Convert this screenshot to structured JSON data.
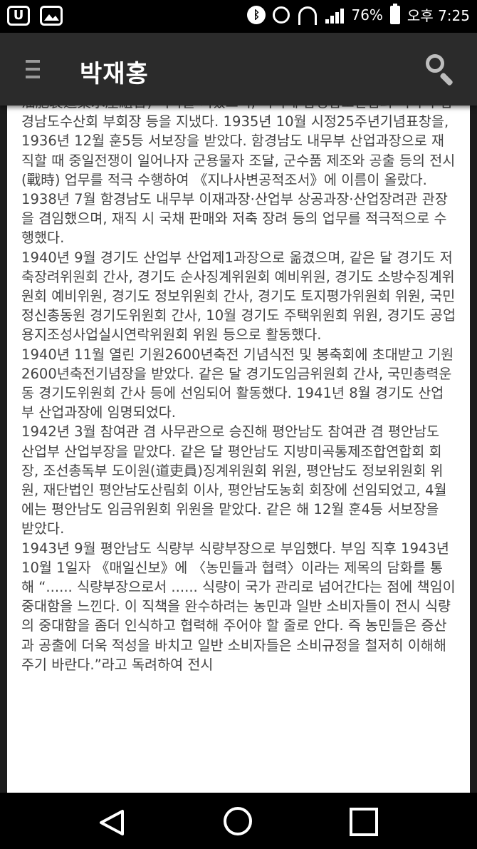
{
  "status_bar": {
    "battery": "76%",
    "time": "오후 7:25",
    "icons": [
      "u-plus-icon",
      "gallery-icon",
      "bluetooth-icon",
      "alarm-icon",
      "wifi-icon",
      "signal-icon",
      "battery-icon"
    ]
  },
  "app_bar": {
    "title": "박재홍",
    "icons": [
      "menu-icon",
      "search-icon"
    ]
  },
  "article": {
    "paragraphs": [
      "油肥製造業水産組合) 이사를 지냈으며, 이외에 함경남도산림회 이사와 함경남도수산회 부회장 등을 지냈다. 1935년 10월 시정25주년기념표창을, 1936년 12월 훈5등 서보장을 받았다. 함경남도 내무부 산업과장으로 재직할 때 중일전쟁이 일어나자 군용물자 조달, 군수품 제조와 공출 등의 전시(戰時) 업무를 적극 수행하여 《지나사변공적조서》에 이름이 올랐다. 1938년 7월 함경남도 내무부 이재과장·산업부 상공과장·산업장려관 관장을 겸임했으며, 재직 시 국채 판매와 저축 장려 등의 업무를 적극적으로 수행했다.",
      "1940년 9월 경기도 산업부 산업제1과장으로 옮겼으며, 같은 달 경기도 저축장려위원회 간사, 경기도 순사징계위원회 예비위원, 경기도 소방수징계위원회 예비위원, 경기도 정보위원회 간사, 경기도 토지평가위원회 위원, 국민정신총동원 경기도위원회 간사, 10월 경기도 주택위원회 위원, 경기도 공업용지조성사업실시연락위원회 위원 등으로 활동했다.",
      "1940년 11월 열린 기원2600년축전 기념식전 및 봉축회에 초대받고 기원2600년축전기념장을 받았다. 같은 달 경기도임금위원회 간사, 국민총력운동 경기도위원회 간사 등에 선임되어 활동했다. 1941년 8월 경기도 산업부 산업과장에 임명되었다.",
      "1942년 3월 참여관 겸 사무관으로 승진해 평안남도 참여관 겸 평안남도 산업부 산업부장을 맡았다. 같은 달 평안남도 지방미곡통제조합연합회 회장, 조선총독부 도이원(道吏員)징계위원회 위원, 평안남도 정보위원회 위원, 재단법인 평안남도산림회 이사, 평안남도농회 회장에 선임되었고, 4월에는 평안남도 임금위원회 위원을 맡았다. 같은 해 12월 훈4등 서보장을 받았다.",
      "1943년 9월 평안남도 식량부 식량부장으로 부임했다. 부임 직후 1943년 10월 1일자 《매일신보》에 〈농민들과 협력〉이라는 제목의 담화를 통해 “...... 식량부장으로서 ...... 식량이 국가 관리로 넘어간다는 점에 책임이 중대함을 느낀다. 이 직책을 완수하려는 농민과 일반 소비자들이 전시 식량의 중대함을 좀더 인식하고 협력해 주어야 할 줄로 안다. 즉 농민들은 증산과 공출에 더욱 적성을 바치고 일반 소비자들은 소비규정을 철저히 이해해 주기 바란다.”라고 독려하여 전시"
    ]
  },
  "nav_bar": {
    "icons": [
      "back-icon",
      "home-icon",
      "recent-apps-icon"
    ]
  }
}
